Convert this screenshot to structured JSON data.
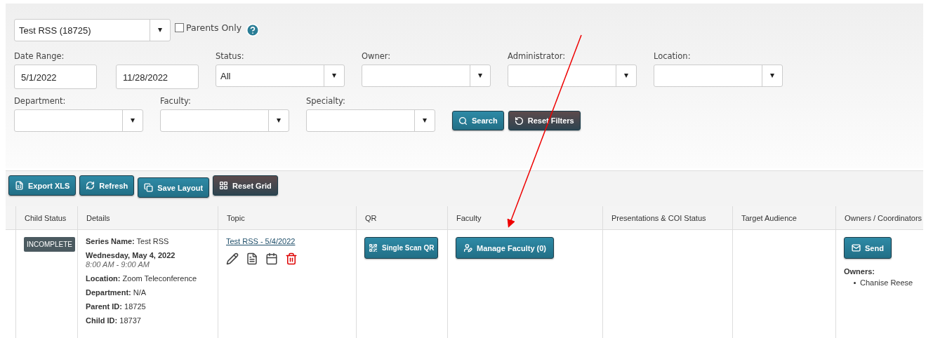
{
  "series_select": {
    "value": "Test RSS (18725)"
  },
  "parents_only": {
    "label": "Parents Only",
    "checked": false
  },
  "filters_row_1": [
    {
      "kind": "daterange",
      "label": "Date Range:",
      "values": [
        "5/1/2022",
        "11/28/2022"
      ]
    },
    {
      "kind": "select",
      "label": "Status:",
      "value": "All"
    },
    {
      "kind": "select",
      "label": "Owner:"
    },
    {
      "kind": "select",
      "label": "Administrator:"
    },
    {
      "kind": "select",
      "label": "Location:"
    }
  ],
  "filters_row_2": [
    {
      "kind": "select",
      "label": "Department:"
    },
    {
      "kind": "select",
      "label": "Faculty:"
    },
    {
      "kind": "select",
      "label": "Specialty:"
    }
  ],
  "filter_buttons": [
    {
      "label": "Search",
      "kind": "primary"
    },
    {
      "label": "Reset Filters",
      "kind": "dark"
    }
  ],
  "toolbar": [
    {
      "label": "Export XLS",
      "kind": "primary"
    },
    {
      "label": "Refresh",
      "kind": "primary"
    },
    {
      "label": "Save Layout",
      "kind": "primary"
    },
    {
      "label": "Reset Grid",
      "kind": "dark"
    }
  ],
  "table": {
    "columns": [
      "Child Status",
      "Details",
      "Topic",
      "QR",
      "Faculty",
      "Presentations & COI Status",
      "Target Audience",
      "Owners / Coordinators"
    ],
    "rows": [
      {
        "status": "INCOMPLETE",
        "details": [
          {
            "kind": "text",
            "text": "**Series Name:** Test RSS"
          },
          {
            "kind": "date",
            "text": "Wednesday, May 4, 2022"
          },
          {
            "kind": "time",
            "text": "8:00 AM - 9:00 AM"
          },
          {
            "kind": "text",
            "text": "**Location:** Zoom Teleconference"
          },
          {
            "kind": "text",
            "text": "**Department:** N/A"
          },
          {
            "kind": "text",
            "text": "**Parent ID:** 18725"
          },
          {
            "kind": "text",
            "text": "**Child ID:** 18737"
          }
        ],
        "topic": "Test RSS - 5/4/2022",
        "qr_button": "Single Scan QR",
        "faculty_button": "Manage Faculty (0)",
        "send_button": "Send",
        "owners_label": "Owners:",
        "owners": [
          "Chanise Reese"
        ]
      }
    ]
  }
}
